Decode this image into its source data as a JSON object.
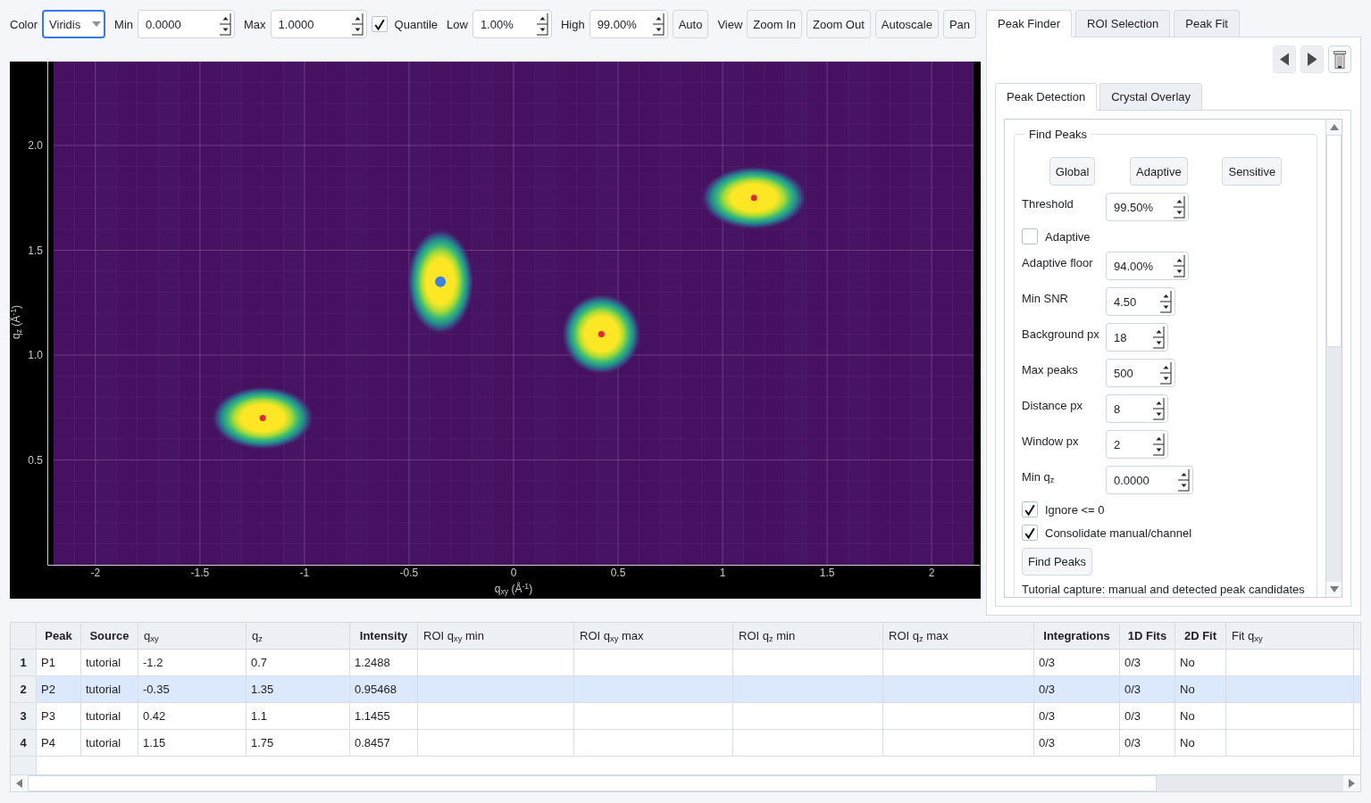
{
  "toolbar": [
    {
      "kind": "label",
      "text": "Color"
    },
    {
      "kind": "select",
      "value": "Viridis",
      "focused": true
    },
    {
      "kind": "label",
      "text": "Min"
    },
    {
      "kind": "spinbox",
      "value": "0.0000"
    },
    {
      "kind": "label",
      "text": "Max"
    },
    {
      "kind": "spinbox",
      "value": "1.0000"
    },
    {
      "kind": "checkbox",
      "label": "Quantile",
      "checked": true
    },
    {
      "kind": "label",
      "text": "Low"
    },
    {
      "kind": "spinbox",
      "value": "1.00%"
    },
    {
      "kind": "label",
      "text": "High"
    },
    {
      "kind": "spinbox",
      "value": "99.00%"
    },
    {
      "kind": "button",
      "text": "Auto"
    },
    {
      "kind": "label",
      "text": "View"
    },
    {
      "kind": "button",
      "text": "Zoom In"
    },
    {
      "kind": "button",
      "text": "Zoom Out"
    },
    {
      "kind": "button",
      "text": "Autoscale"
    },
    {
      "kind": "button",
      "text": "Pan"
    }
  ],
  "tabs": [
    {
      "label": "Peak Finder",
      "selected": true
    },
    {
      "label": "ROI Selection",
      "selected": false
    },
    {
      "label": "Peak Fit",
      "selected": false
    }
  ],
  "plot": {
    "chart_data": {
      "type": "scatter",
      "xlabel": "q$_{xy}$ (Å$^{-1}$)",
      "ylabel": "q$_{z}$ (Å$^{-1}$)",
      "x": [
        -1.2,
        -0.35,
        0.42,
        1.15
      ],
      "series": [
        {
          "color": "#e3263b",
          "values": [
            0.7,
            null,
            1.1,
            1.75
          ]
        },
        {
          "color": "#3d7fe8",
          "values": [
            null,
            1.35,
            null,
            null
          ]
        }
      ],
      "xlim": [
        -2.23,
        2.23
      ],
      "ylim": [
        0,
        2.4
      ],
      "xticks": [
        {
          "value": -2,
          "label": "-2"
        },
        {
          "value": -1.5,
          "label": "-1.5"
        },
        {
          "value": -1,
          "label": "-1"
        },
        {
          "value": -0.5,
          "label": "-0.5"
        },
        {
          "value": 0,
          "label": "0"
        },
        {
          "value": 0.5,
          "label": "0.5"
        },
        {
          "value": 1,
          "label": "1"
        },
        {
          "value": 1.5,
          "label": "1.5"
        },
        {
          "value": 2,
          "label": "2"
        }
      ],
      "yticks": [
        {
          "value": 0.5,
          "label": "0.5"
        },
        {
          "value": 1,
          "label": "1.0"
        },
        {
          "value": 1.5,
          "label": "1.5"
        },
        {
          "value": 2,
          "label": "2.0"
        }
      ],
      "grid": true
    }
  },
  "peak_finder": {
    "subtabs": [
      {
        "label": "Peak Detection",
        "selected": true
      },
      {
        "label": "Crystal Overlay",
        "selected": false
      }
    ],
    "group": {
      "title": "Find Peaks",
      "presets": [
        "Global",
        "Adaptive",
        "Sensitive"
      ],
      "fields": [
        {
          "kind": "spinbox",
          "label": "Threshold",
          "value": "99.50%"
        },
        {
          "kind": "checkbox",
          "label": "Adaptive",
          "checked": false
        },
        {
          "kind": "spinbox",
          "label": "Adaptive floor",
          "value": "94.00%"
        },
        {
          "kind": "spinbox",
          "label": "Min SNR",
          "value": "4.50"
        },
        {
          "kind": "spinbox",
          "label": "Background px",
          "value": "18"
        },
        {
          "kind": "spinbox",
          "label": "Max peaks",
          "value": "500"
        },
        {
          "kind": "spinbox",
          "label": "Distance px",
          "value": "8"
        },
        {
          "kind": "spinbox",
          "label": "Window px",
          "value": "2"
        },
        {
          "kind": "spinbox",
          "label": "Min q$_{z}$",
          "value": "0.0000"
        },
        {
          "kind": "checkbox",
          "label": "Ignore <= 0",
          "checked": true
        },
        {
          "kind": "checkbox",
          "label": "Consolidate manual/channel",
          "checked": true
        },
        {
          "kind": "button",
          "label": "Find Peaks"
        },
        {
          "kind": "note",
          "label": "Tutorial capture: manual and detected peak candidates"
        }
      ]
    }
  },
  "table": {
    "columns": [
      {
        "label": "Peak",
        "bold": true
      },
      {
        "label": "Source",
        "bold": true
      },
      {
        "label": "q$_{xy}$",
        "bold": false
      },
      {
        "label": "q$_{z}$",
        "bold": false
      },
      {
        "label": "Intensity",
        "bold": true
      },
      {
        "label": "ROI q$_{xy}$ min",
        "bold": false
      },
      {
        "label": "ROI q$_{xy}$ max",
        "bold": false
      },
      {
        "label": "ROI q$_{z}$ min",
        "bold": false
      },
      {
        "label": "ROI q$_{z}$ max",
        "bold": false
      },
      {
        "label": "Integrations",
        "bold": true
      },
      {
        "label": "1D Fits",
        "bold": true
      },
      {
        "label": "2D Fit",
        "bold": true
      },
      {
        "label": "Fit q$_{xy}$",
        "bold": false
      }
    ],
    "rows": [
      {
        "number": "1",
        "selected": false,
        "peak": "P1",
        "source": "tutorial",
        "qxy": "-1.2",
        "qz": "0.7",
        "intensity": "1.2488",
        "integrations": "0/3",
        "fits_1d": "0/3",
        "fit_2d": "No"
      },
      {
        "number": "2",
        "selected": true,
        "peak": "P2",
        "source": "tutorial",
        "qxy": "-0.35",
        "qz": "1.35",
        "intensity": "0.95468",
        "integrations": "0/3",
        "fits_1d": "0/3",
        "fit_2d": "No"
      },
      {
        "number": "3",
        "selected": false,
        "peak": "P3",
        "source": "tutorial",
        "qxy": "0.42",
        "qz": "1.1",
        "intensity": "1.1455",
        "integrations": "0/3",
        "fits_1d": "0/3",
        "fit_2d": "No"
      },
      {
        "number": "4",
        "selected": false,
        "peak": "P4",
        "source": "tutorial",
        "qxy": "1.15",
        "qz": "1.75",
        "intensity": "0.8457",
        "integrations": "0/3",
        "fits_1d": "0/3",
        "fit_2d": "No"
      }
    ]
  }
}
